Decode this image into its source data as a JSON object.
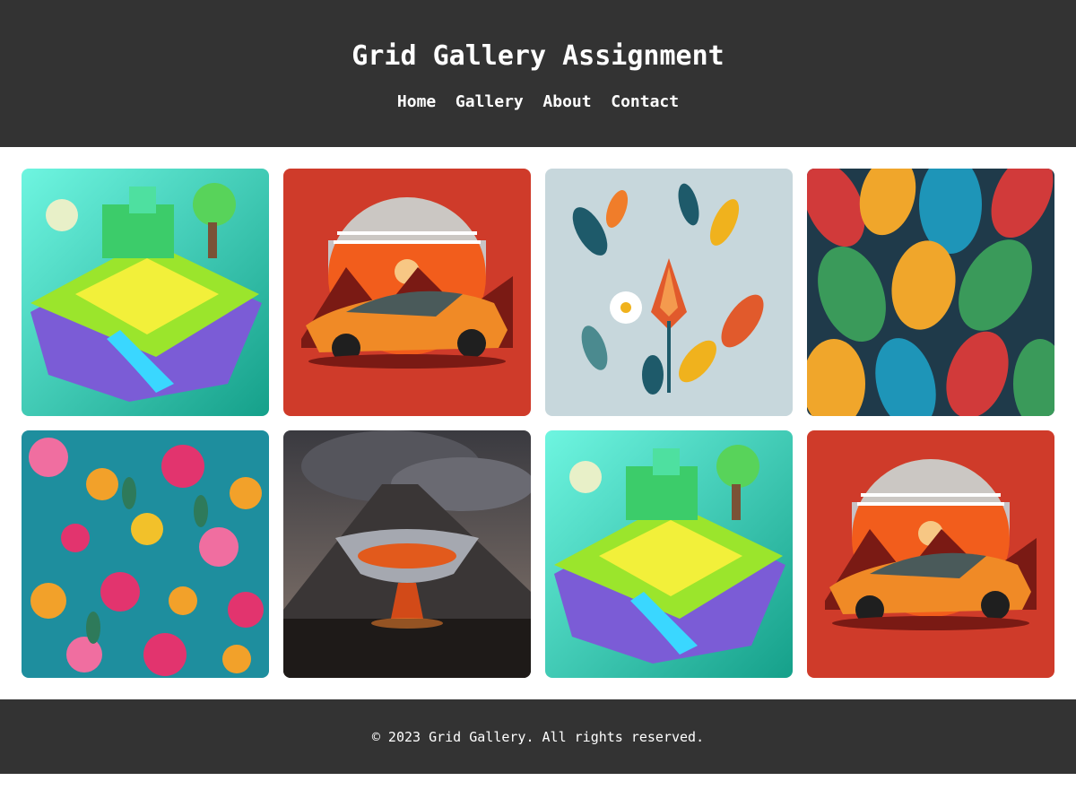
{
  "header": {
    "title": "Grid Gallery Assignment",
    "nav": [
      "Home",
      "Gallery",
      "About",
      "Contact"
    ]
  },
  "gallery": {
    "images": [
      {
        "subject": "isometric island",
        "icon": "island-image"
      },
      {
        "subject": "orange sports car at sunset",
        "icon": "car-image"
      },
      {
        "subject": "botanical flowers",
        "icon": "botanical-image"
      },
      {
        "subject": "colorful leaves pattern",
        "icon": "leaves-image"
      },
      {
        "subject": "flower pattern",
        "icon": "flowers-image"
      },
      {
        "subject": "volcano with glass bowl",
        "icon": "volcano-image"
      },
      {
        "subject": "isometric island",
        "icon": "island-image"
      },
      {
        "subject": "orange sports car at sunset",
        "icon": "car-image"
      }
    ]
  },
  "footer": {
    "text": "© 2023 Grid Gallery. All rights reserved."
  },
  "colors": {
    "header_bg": "#333333",
    "footer_bg": "#333333",
    "text": "#ffffff"
  }
}
